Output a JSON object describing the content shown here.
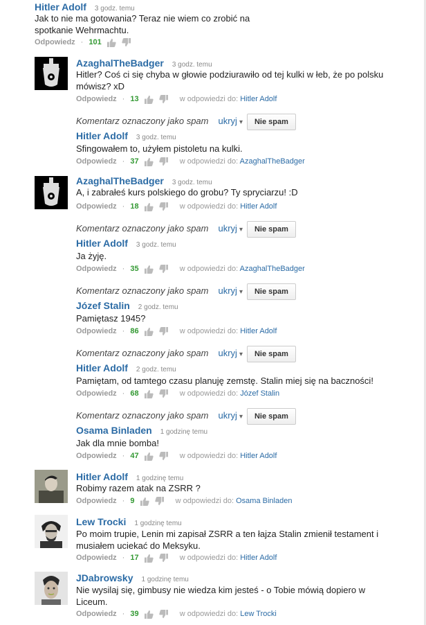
{
  "labels": {
    "reply": "Odpowiedz",
    "in_reply": "w odpowiedzi do:",
    "spam_text": "Komentarz oznaczony jako spam",
    "hide": "ukryj",
    "not_spam": "Nie spam"
  },
  "comments": [
    {
      "author": "Hitler Adolf",
      "time": "3 godz. temu",
      "text": "Jak to nie ma gotowania? Teraz nie wiem co zrobić na spotkanie Wehrmachtu.",
      "votes": "101",
      "reply_to": ""
    },
    {
      "author": "AzaghalTheBadger",
      "time": "3 godz. temu",
      "text": "Hitler? Coś ci się chyba w głowie podziurawiło od tej kulki w łeb, że po polsku mówisz? xD",
      "votes": "13",
      "reply_to": "Hitler Adolf"
    },
    {
      "author": "Hitler Adolf",
      "time": "3 godz. temu",
      "text": "Sfingowałem to, użyłem pistoletu na kulki.",
      "votes": "37",
      "reply_to": "AzaghalTheBadger"
    },
    {
      "author": "AzaghalTheBadger",
      "time": "3 godz. temu",
      "text": "A, i zabrałeś kurs polskiego do grobu? Ty spryciarzu! :D",
      "votes": "18",
      "reply_to": "Hitler Adolf"
    },
    {
      "author": "Hitler Adolf",
      "time": "3 godz. temu",
      "text": "Ja żyję.",
      "votes": "35",
      "reply_to": "AzaghalTheBadger"
    },
    {
      "author": "Józef Stalin",
      "time": "2 godz. temu",
      "text": "Pamiętasz 1945?",
      "votes": "86",
      "reply_to": "Hitler Adolf"
    },
    {
      "author": "Hitler Adolf",
      "time": "2 godz. temu",
      "text": "Pamiętam, od tamtego czasu planuję zemstę. Stalin miej się na baczności!",
      "votes": "68",
      "reply_to": "Józef Stalin"
    },
    {
      "author": "Osama Binladen",
      "time": "1 godzinę temu",
      "text": "Jak dla mnie bomba!",
      "votes": "47",
      "reply_to": "Hitler Adolf"
    },
    {
      "author": "Hitler Adolf",
      "time": "1 godzinę temu",
      "text": "Robimy razem atak na ZSRR ?",
      "votes": "9",
      "reply_to": "Osama Binladen"
    },
    {
      "author": "Lew Trocki",
      "time": "1 godzinę temu",
      "text": "Po moim trupie, Lenin mi zapisał ZSRR a ten łajza Stalin zmienił testament i musiałem uciekać do Meksyku.",
      "votes": "17",
      "reply_to": "Hitler Adolf"
    },
    {
      "author": "JDabrowsky",
      "time": "1 godzinę temu",
      "text": "Nie wysilaj się, gimbusy nie wiedza kim jesteś - o Tobie mówią dopiero w Liceum.",
      "votes": "39",
      "reply_to": "Lew Trocki"
    }
  ]
}
